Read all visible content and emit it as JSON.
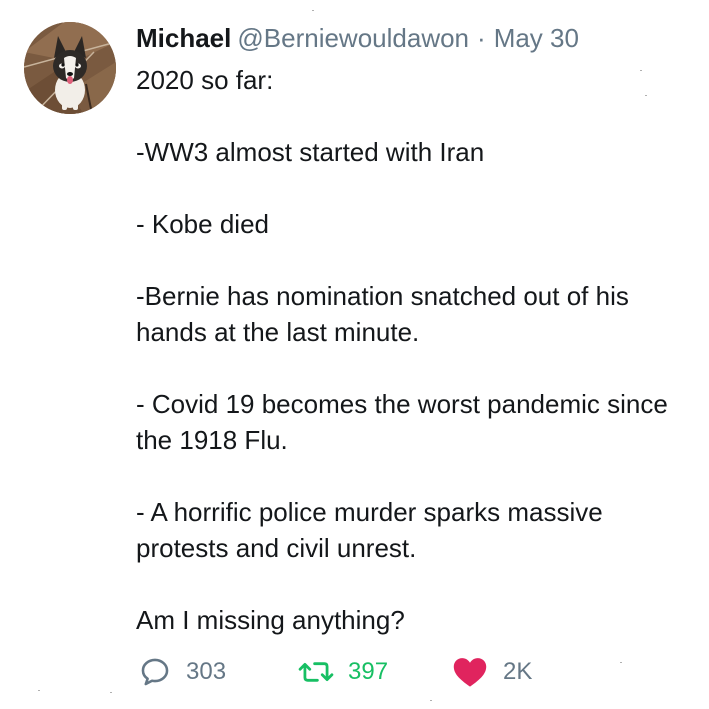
{
  "tweet": {
    "author": {
      "name": "Michael",
      "handle": "@Berniewouldawon",
      "avatar_icon": "husky-puppy-avatar"
    },
    "separator": "·",
    "date": "May 30",
    "paragraphs": [
      "2020 so far:",
      "-WW3 almost started with Iran",
      "- Kobe died",
      "-Bernie has nomination snatched out of his hands at the last minute.",
      "- Covid 19 becomes the worst pandemic since the 1918 Flu.",
      "- A horrific police murder sparks massive protests and civil unrest.",
      "Am I missing anything?"
    ],
    "actions": {
      "reply": {
        "icon": "reply-bubble-icon",
        "count": "303",
        "color": "#657786"
      },
      "retweet": {
        "icon": "retweet-icon",
        "count": "397",
        "color": "#17bf63"
      },
      "like": {
        "icon": "heart-icon",
        "count": "2K",
        "color": "#e0245e"
      }
    }
  }
}
